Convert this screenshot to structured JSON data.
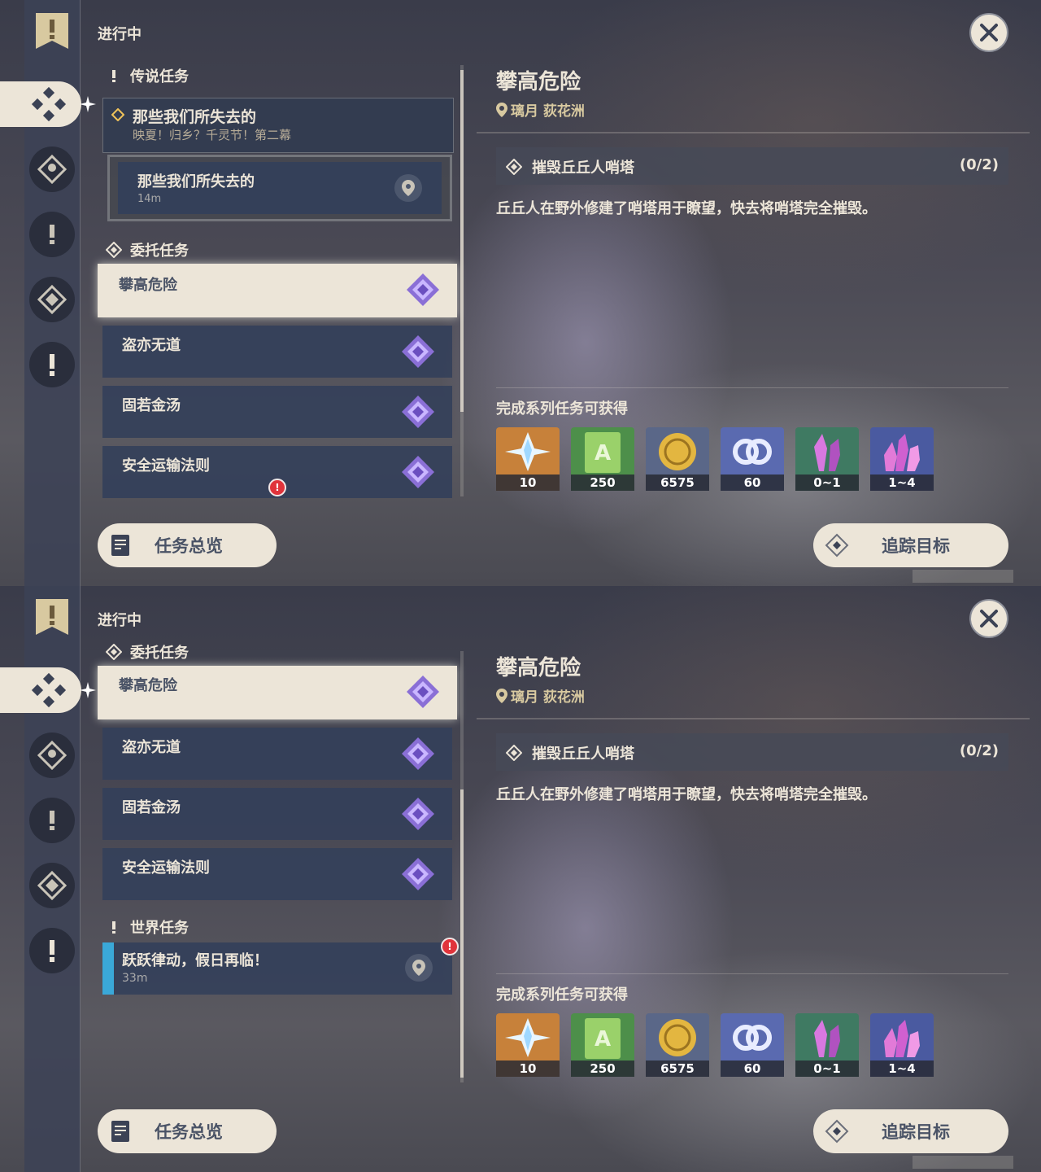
{
  "colors": {
    "accent": "#ece5d8",
    "panel_row": "#34405a",
    "world_bar": "#3aa8d8",
    "badge": "#e0333b"
  },
  "header": {
    "in_progress": "进行中"
  },
  "sections": {
    "legend": "传说任务",
    "commission": "委托任务",
    "world": "世界任务"
  },
  "story": {
    "title": "那些我们所失去的",
    "subtitle": "映夏！归乡？千灵节！第二幕",
    "sub_title": "那些我们所失去的",
    "sub_distance": "14m"
  },
  "commissions": [
    {
      "title": "攀高危险"
    },
    {
      "title": "盗亦无道"
    },
    {
      "title": "固若金汤"
    },
    {
      "title": "安全运输法则"
    }
  ],
  "world_quest": {
    "title": "跃跃律动，假日再临！",
    "distance": "33m"
  },
  "badge": {
    "text": "!"
  },
  "detail": {
    "title": "攀高危险",
    "location": "璃月 荻花洲",
    "objective": "摧毁丘丘人哨塔",
    "progress": "(0/2)",
    "description": "丘丘人在野外修建了哨塔用于瞭望，快去将哨塔完全摧毁。",
    "rewards_title": "完成系列任务可获得",
    "rewards": [
      {
        "icon": "primogem-icon",
        "qty": "10"
      },
      {
        "icon": "adventure-exp-icon",
        "qty": "250"
      },
      {
        "icon": "mora-icon",
        "qty": "6575"
      },
      {
        "icon": "companionship-exp-icon",
        "qty": "60"
      },
      {
        "icon": "refinement-ore-icon",
        "qty": "0~1"
      },
      {
        "icon": "mystic-ore-icon",
        "qty": "1~4"
      }
    ]
  },
  "buttons": {
    "overview": "任务总览",
    "track": "追踪目标"
  }
}
